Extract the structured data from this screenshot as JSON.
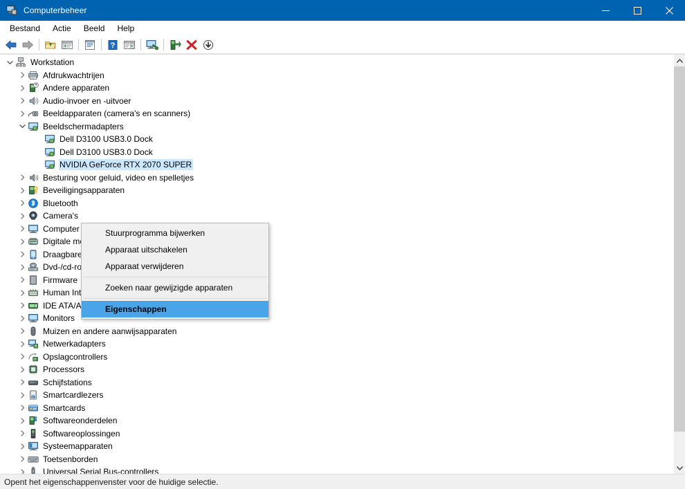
{
  "window": {
    "title": "Computerbeheer",
    "icon": "computer-management-icon",
    "accent_color": "#0063b1",
    "minimize_label": "─",
    "maximize_label": "□",
    "close_label": "✕"
  },
  "menubar": {
    "items": [
      {
        "label": "Bestand",
        "name": "menu-bestand"
      },
      {
        "label": "Actie",
        "name": "menu-actie"
      },
      {
        "label": "Beeld",
        "name": "menu-beeld"
      },
      {
        "label": "Help",
        "name": "menu-help"
      }
    ]
  },
  "toolbar": {
    "buttons": [
      {
        "icon": "back-arrow-icon",
        "label": "Vorige"
      },
      {
        "icon": "forward-arrow-icon",
        "label": "Volgende"
      },
      {
        "icon": "up-folder-icon",
        "label": "Omhoog"
      },
      {
        "icon": "show-hide-console-tree-icon",
        "label": "Consolestructuur weergeven/verbergen"
      },
      {
        "icon": "properties-icon",
        "label": "Eigenschappen"
      },
      {
        "icon": "help-icon",
        "label": "Help"
      },
      {
        "icon": "show-hide-action-pane-icon",
        "label": "Actievenster weergeven/verbergen"
      },
      {
        "icon": "scan-hardware-icon",
        "label": "Zoeken naar gewijzigde apparaten"
      },
      {
        "icon": "update-driver-icon",
        "label": "Stuurprogramma bijwerken"
      },
      {
        "icon": "uninstall-device-icon",
        "label": "Apparaat verwijderen"
      },
      {
        "icon": "disable-device-icon",
        "label": "Apparaat uitschakelen"
      }
    ]
  },
  "tree": {
    "rows": [
      {
        "label": "Workstation",
        "depth": 0,
        "state": "open",
        "icon": "workstation-icon",
        "selected": false
      },
      {
        "label": "Afdrukwachtrijen",
        "depth": 1,
        "state": "closed",
        "icon": "print-queue-icon",
        "selected": false
      },
      {
        "label": "Andere apparaten",
        "depth": 1,
        "state": "closed",
        "icon": "other-devices-icon",
        "selected": false
      },
      {
        "label": "Audio-invoer en -uitvoer",
        "depth": 1,
        "state": "closed",
        "icon": "audio-io-icon",
        "selected": false
      },
      {
        "label": "Beeldapparaten (camera's en scanners)",
        "depth": 1,
        "state": "closed",
        "icon": "imaging-devices-icon",
        "selected": false
      },
      {
        "label": "Beeldschermadapters",
        "depth": 1,
        "state": "open",
        "icon": "display-adapters-icon",
        "selected": false
      },
      {
        "label": "Dell D3100 USB3.0 Dock",
        "depth": 2,
        "state": "leaf",
        "icon": "display-adapter-icon",
        "selected": false
      },
      {
        "label": "Dell D3100 USB3.0 Dock",
        "depth": 2,
        "state": "leaf",
        "icon": "display-adapter-icon",
        "selected": false
      },
      {
        "label": "NVIDIA GeForce RTX 2070 SUPER",
        "depth": 2,
        "state": "leaf",
        "icon": "display-adapter-icon",
        "selected": true
      },
      {
        "label": "Besturing voor geluid, video en spelletjes",
        "depth": 1,
        "state": "closed",
        "icon": "sound-video-game-icon",
        "selected": false
      },
      {
        "label": "Beveiligingsapparaten",
        "depth": 1,
        "state": "closed",
        "icon": "security-devices-icon",
        "selected": false
      },
      {
        "label": "Bluetooth",
        "depth": 1,
        "state": "closed",
        "icon": "bluetooth-icon",
        "selected": false
      },
      {
        "label": "Camera's",
        "depth": 1,
        "state": "closed",
        "icon": "camera-icon",
        "selected": false
      },
      {
        "label": "Computer",
        "depth": 1,
        "state": "closed",
        "icon": "computer-icon",
        "selected": false
      },
      {
        "label": "Digitale mediaapparaten",
        "depth": 1,
        "state": "closed",
        "icon": "digital-media-icon",
        "selected": false
      },
      {
        "label": "Draagbare apparaten",
        "depth": 1,
        "state": "closed",
        "icon": "portable-devices-icon",
        "selected": false
      },
      {
        "label": "Dvd-/cd-rom-stations",
        "depth": 1,
        "state": "closed",
        "icon": "dvd-cdrom-icon",
        "selected": false
      },
      {
        "label": "Firmware",
        "depth": 1,
        "state": "closed",
        "icon": "firmware-icon",
        "selected": false
      },
      {
        "label": "Human Interface-apparaten (HID)",
        "depth": 1,
        "state": "closed",
        "icon": "hid-icon",
        "selected": false
      },
      {
        "label": "IDE ATA/ATAPI-controllers",
        "depth": 1,
        "state": "closed",
        "icon": "ide-controller-icon",
        "selected": false
      },
      {
        "label": "Monitors",
        "depth": 1,
        "state": "closed",
        "icon": "monitor-icon",
        "selected": false
      },
      {
        "label": "Muizen en andere aanwijsapparaten",
        "depth": 1,
        "state": "closed",
        "icon": "mouse-icon",
        "selected": false
      },
      {
        "label": "Netwerkadapters",
        "depth": 1,
        "state": "closed",
        "icon": "network-adapter-icon",
        "selected": false
      },
      {
        "label": "Opslagcontrollers",
        "depth": 1,
        "state": "closed",
        "icon": "storage-controller-icon",
        "selected": false
      },
      {
        "label": "Processors",
        "depth": 1,
        "state": "closed",
        "icon": "processor-icon",
        "selected": false
      },
      {
        "label": "Schijfstations",
        "depth": 1,
        "state": "closed",
        "icon": "disk-drive-icon",
        "selected": false
      },
      {
        "label": "Smartcardlezers",
        "depth": 1,
        "state": "closed",
        "icon": "smartcard-reader-icon",
        "selected": false
      },
      {
        "label": "Smartcards",
        "depth": 1,
        "state": "closed",
        "icon": "smartcard-icon",
        "selected": false
      },
      {
        "label": "Softwareonderdelen",
        "depth": 1,
        "state": "closed",
        "icon": "software-components-icon",
        "selected": false
      },
      {
        "label": "Softwareoplossingen",
        "depth": 1,
        "state": "closed",
        "icon": "software-devices-icon",
        "selected": false
      },
      {
        "label": "Systeemapparaten",
        "depth": 1,
        "state": "closed",
        "icon": "system-devices-icon",
        "selected": false
      },
      {
        "label": "Toetsenborden",
        "depth": 1,
        "state": "closed",
        "icon": "keyboard-icon",
        "selected": false
      },
      {
        "label": "Universal Serial Bus-controllers",
        "depth": 1,
        "state": "closed",
        "icon": "usb-controller-icon",
        "selected": false
      }
    ]
  },
  "context_menu": {
    "highlight_color": "#4aa5e8",
    "items": [
      {
        "label": "Stuurprogramma bijwerken",
        "type": "item",
        "highlight": false
      },
      {
        "label": "Apparaat uitschakelen",
        "type": "item",
        "highlight": false
      },
      {
        "label": "Apparaat verwijderen",
        "type": "item",
        "highlight": false
      },
      {
        "label": "",
        "type": "separator",
        "highlight": false
      },
      {
        "label": "Zoeken naar gewijzigde apparaten",
        "type": "item",
        "highlight": false
      },
      {
        "label": "",
        "type": "separator",
        "highlight": false
      },
      {
        "label": "Eigenschappen",
        "type": "item",
        "highlight": true
      }
    ]
  },
  "statusbar": {
    "text": "Opent het eigenschappenvenster voor de huidige selectie."
  },
  "scrollbar": {
    "up_arrow": "⌃",
    "down_arrow": "⌄"
  }
}
